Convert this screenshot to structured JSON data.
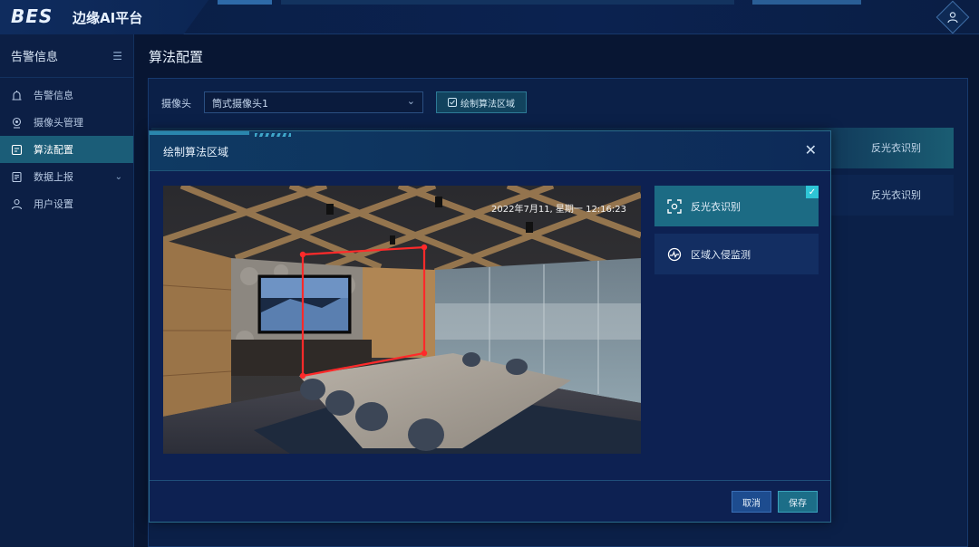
{
  "header": {
    "logo": "BES",
    "app_title": "边缘AI平台",
    "user_icon": "user-icon"
  },
  "sidebar": {
    "title": "告警信息",
    "collapse_icon": "collapse-icon",
    "items": [
      {
        "label": "告警信息",
        "icon": "alarm-icon",
        "active": false
      },
      {
        "label": "摄像头管理",
        "icon": "camera-icon",
        "active": false
      },
      {
        "label": "算法配置",
        "icon": "config-icon",
        "active": true
      },
      {
        "label": "数据上报",
        "icon": "report-icon",
        "active": false,
        "expandable": true
      },
      {
        "label": "用户设置",
        "icon": "user-icon",
        "active": false
      }
    ]
  },
  "main": {
    "page_title": "算法配置",
    "camera_label": "摄像头",
    "camera_selected": "筒式摄像头1",
    "draw_button": "绘制算法区域",
    "rows": [
      "反光衣识别",
      "反光衣识别"
    ]
  },
  "modal": {
    "title": "绘制算法区域",
    "timestamp": "2022年7月11, 星期一 12:16:23",
    "algorithms": [
      {
        "label": "反光衣识别",
        "icon": "scan-icon",
        "selected": true
      },
      {
        "label": "区域入侵监测",
        "icon": "pulse-icon",
        "selected": false
      }
    ],
    "cancel_label": "取消",
    "save_label": "保存"
  },
  "colors": {
    "accent": "#1c6b84",
    "region": "#ff2a2a",
    "check": "#2ec5d6"
  }
}
